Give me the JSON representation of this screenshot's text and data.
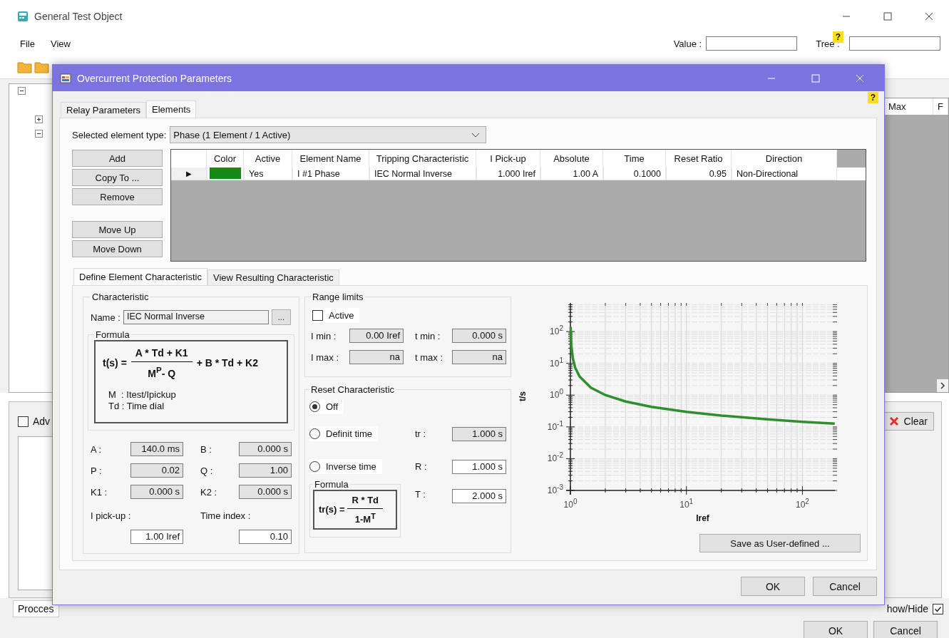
{
  "window": {
    "title": "General Test Object"
  },
  "menu": [
    "File",
    "View"
  ],
  "search": {
    "value_label": "Value :",
    "tree_label": "Tree :",
    "help": "?"
  },
  "background": {
    "columns": [
      "Max",
      "F"
    ],
    "advanced": {
      "label": "Adv",
      "checked": false
    },
    "clear_button": "Clear",
    "tab": "Procces",
    "show_hide": {
      "label": "how/Hide",
      "checked": true
    },
    "buttons": [
      "OK",
      "Cancel"
    ]
  },
  "dialog": {
    "title": "Overcurrent Protection Parameters",
    "help": "?",
    "tabs": [
      {
        "label": "Relay Parameters",
        "selected": false
      },
      {
        "label": "Elements",
        "selected": true
      }
    ],
    "element_type": {
      "label": "Selected element type:",
      "value": "Phase (1 Element / 1 Active)"
    },
    "side_buttons": [
      "Add",
      "Copy To ...",
      "Remove",
      "Move Up",
      "Move Down"
    ],
    "table": {
      "columns": [
        "",
        "Color",
        "Active",
        "Element Name",
        "Tripping Characteristic",
        "I Pick-up",
        "Absolute",
        "Time",
        "Reset Ratio",
        "Direction"
      ],
      "rows": [
        {
          "color": "#138a13",
          "cells": [
            "▶",
            "",
            "Yes",
            "I #1 Phase",
            "IEC Normal Inverse",
            "1.000 Iref",
            "1.00 A",
            "0.1000",
            "0.95",
            "Non-Directional"
          ]
        }
      ]
    },
    "sub_tabs": [
      {
        "label": "Define Element Characteristic",
        "selected": true
      },
      {
        "label": "View Resulting Characteristic",
        "selected": false
      }
    ],
    "characteristic": {
      "title": "Characteristic",
      "name_label": "Name :",
      "name": "IEC Normal Inverse",
      "browse": "...",
      "formula_title": "Formula",
      "formula": {
        "lhs": "t(s) =",
        "numerator": "A * Td + K1",
        "denominator": "M$^{P}$- Q",
        "rest": "+ B * Td + K2"
      },
      "notes": [
        "M  : Itest/Ipickup",
        "Td : Time dial"
      ],
      "params": [
        {
          "label": "A :",
          "value": "140.0 ms",
          "disabled": true
        },
        {
          "label": "B :",
          "value": "0.000 s",
          "disabled": true
        },
        {
          "label": "P :",
          "value": "0.02",
          "disabled": true
        },
        {
          "label": "Q :",
          "value": "1.00",
          "disabled": true
        },
        {
          "label": "K1 :",
          "value": "0.000 s",
          "disabled": true
        },
        {
          "label": "K2 :",
          "value": "0.000 s",
          "disabled": true
        },
        {
          "label": "I pick-up :",
          "value": "1.00 Iref",
          "disabled": false
        },
        {
          "label": "Time index :",
          "value": "0.10",
          "disabled": false
        }
      ]
    },
    "range_limits": {
      "title": "Range limits",
      "active": {
        "label": "Active",
        "checked": false
      },
      "fields": [
        {
          "label": "I min :",
          "value": "0.00 Iref",
          "disabled": true
        },
        {
          "label": "t min :",
          "value": "0.000 s",
          "disabled": true
        },
        {
          "label": "I max :",
          "value": "na",
          "disabled": true
        },
        {
          "label": "t max :",
          "value": "na",
          "disabled": true
        }
      ]
    },
    "reset": {
      "title": "Reset Characteristic",
      "options": [
        {
          "label": "Off",
          "selected": true
        },
        {
          "label": "Definit time",
          "selected": false
        },
        {
          "label": "Inverse time",
          "selected": false
        }
      ],
      "fields": [
        {
          "label": "tr :",
          "value": "1.000 s",
          "disabled": true
        },
        {
          "label": "R :",
          "value": "1.000 s",
          "disabled": false
        },
        {
          "label": "T :",
          "value": "2.000 s",
          "disabled": false
        }
      ],
      "formula_title": "Formula",
      "formula": {
        "lhs": "tr(s) =",
        "numerator": "R * Td",
        "denominator": "1-M$^{T}$"
      }
    },
    "chart": {
      "xlabel": "Iref",
      "ylabel": "t/s",
      "x_tick_labels": [
        "10$^{0}$",
        "10$^{1}$",
        "10$^{2}$"
      ],
      "y_tick_labels": [
        "10$^{2}$",
        "10$^{1}$",
        "10$^{0}$",
        "10$^{-1}$",
        "10$^{-2}$",
        "10$^{-3}$"
      ]
    },
    "save_button": "Save as User-defined ...",
    "buttons": [
      "OK",
      "Cancel"
    ]
  }
}
